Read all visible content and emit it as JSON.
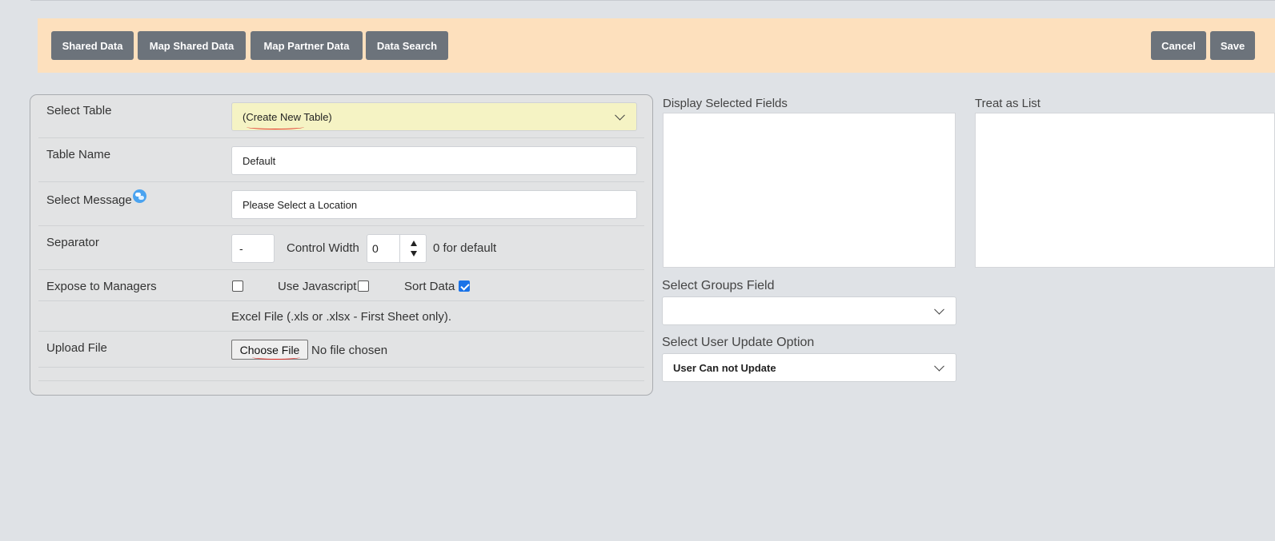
{
  "toolbar": {
    "shared_data": "Shared Data",
    "map_shared_data": "Map Shared Data",
    "map_partner_data": "Map Partner Data",
    "data_search": "Data Search",
    "cancel": "Cancel",
    "save": "Save"
  },
  "form": {
    "select_table_label": "Select Table",
    "select_table_value": "(Create New Table)",
    "table_name_label": "Table Name",
    "table_name_value": "Default",
    "select_message_label": "Select Message",
    "select_message_value": "Please Select a Location",
    "separator_label": "Separator",
    "separator_value": "-",
    "control_width_label": "Control Width",
    "control_width_value": "0",
    "control_width_hint": "0 for default",
    "expose_label": "Expose to Managers",
    "use_js_label": "Use Javascript",
    "sort_data_label": "Sort Data",
    "excel_note": "Excel File (.xls or .xlsx - First Sheet only).",
    "upload_label": "Upload File",
    "choose_file": "Choose File",
    "no_file": "No file chosen"
  },
  "side": {
    "display_fields_label": "Display Selected Fields",
    "treat_as_list_label": "Treat as List",
    "groups_field_label": "Select Groups Field",
    "groups_field_value": "",
    "user_update_label": "Select User Update Option",
    "user_update_value": "User Can not Update"
  },
  "colors": {
    "toolbar_bg": "#fde0bd",
    "button_bg": "#6c737b",
    "select_highlight": "#f5f3c4",
    "checkbox_checked": "#1a73e8",
    "annotation_red": "#e0201a"
  }
}
